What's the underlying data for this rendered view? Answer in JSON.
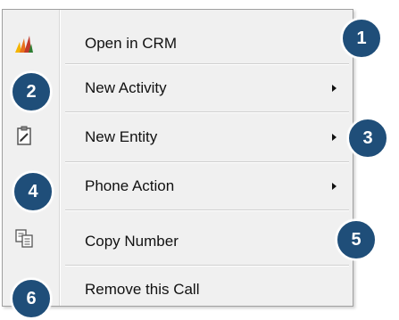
{
  "menu": {
    "items": [
      {
        "label": "Open in CRM",
        "icon": "dynamics-crm-icon",
        "submenu": false
      },
      {
        "label": "New Activity",
        "icon": "",
        "submenu": true
      },
      {
        "label": "New Entity",
        "icon": "clipboard-edit-icon",
        "submenu": true
      },
      {
        "label": "Phone Action",
        "icon": "",
        "submenu": true
      },
      {
        "label": "Copy Number",
        "icon": "copy-icon",
        "submenu": false
      },
      {
        "label": "Remove this Call",
        "icon": "",
        "submenu": false
      }
    ]
  },
  "callouts": [
    "1",
    "2",
    "3",
    "4",
    "5",
    "6"
  ],
  "colors": {
    "callout": "#1f4e79",
    "menu_bg": "#f0f0f0"
  }
}
